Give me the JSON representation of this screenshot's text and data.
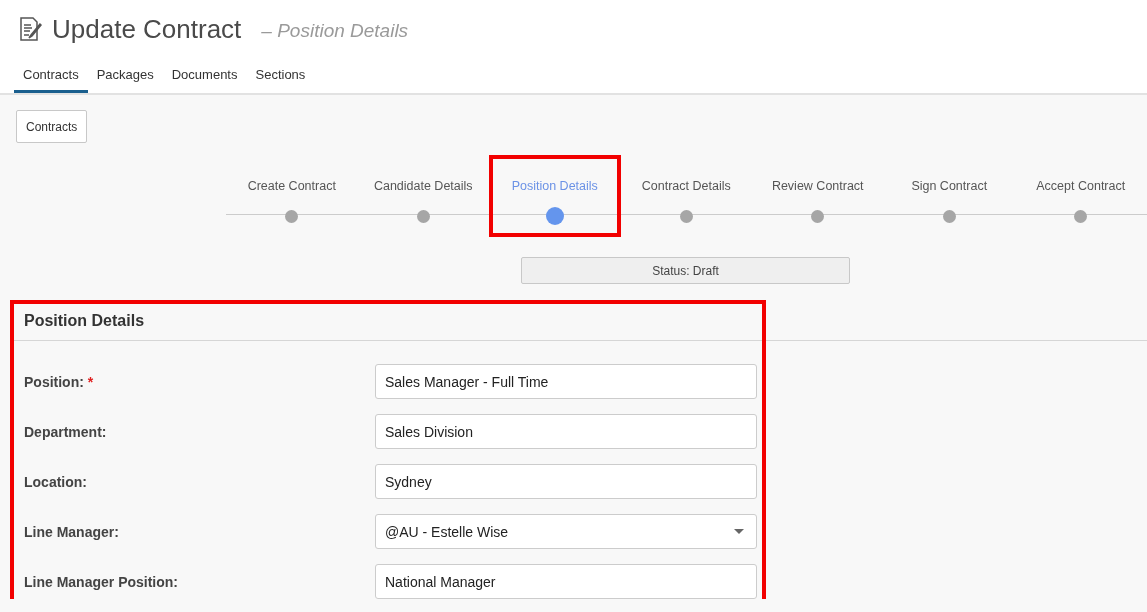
{
  "header": {
    "title": "Update Contract",
    "subtitle": "– Position Details"
  },
  "tabs": [
    {
      "label": "Contracts",
      "selected": true
    },
    {
      "label": "Packages",
      "selected": false
    },
    {
      "label": "Documents",
      "selected": false
    },
    {
      "label": "Sections",
      "selected": false
    }
  ],
  "back_button": "Contracts",
  "steps": [
    {
      "label": "Create Contract",
      "selected": false,
      "highlighted": false
    },
    {
      "label": "Candidate Details",
      "selected": false,
      "highlighted": false
    },
    {
      "label": "Position Details",
      "selected": true,
      "highlighted": true
    },
    {
      "label": "Contract Details",
      "selected": false,
      "highlighted": false
    },
    {
      "label": "Review Contract",
      "selected": false,
      "highlighted": false
    },
    {
      "label": "Sign Contract",
      "selected": false,
      "highlighted": false
    },
    {
      "label": "Accept Contract",
      "selected": false,
      "highlighted": false
    }
  ],
  "status": "Status: Draft",
  "section": {
    "title": "Position Details",
    "highlighted": true,
    "fields": [
      {
        "label": "Position:",
        "required_mark": "*",
        "kind": "text",
        "value": "Sales Manager - Full Time"
      },
      {
        "label": "Department:",
        "kind": "text",
        "value": "Sales Division"
      },
      {
        "label": "Location:",
        "kind": "text",
        "value": "Sydney"
      },
      {
        "label": "Line Manager:",
        "kind": "select",
        "value": "@AU - Estelle Wise"
      },
      {
        "label": "Line Manager Position:",
        "kind": "text",
        "value": "National Manager"
      }
    ]
  }
}
